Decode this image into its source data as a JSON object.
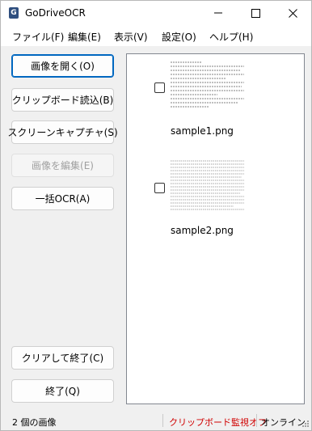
{
  "window": {
    "title": "GoDriveOCR",
    "icon": "G",
    "controls": [
      "minimize-icon",
      "maximize-icon",
      "close-icon"
    ]
  },
  "menu": {
    "file": "ファイル(F)",
    "edit": "編集(E)",
    "view": "表示(V)",
    "settings": "設定(O)",
    "help": "ヘルプ(H)"
  },
  "buttons": {
    "open_image": "画像を開く(O)",
    "clipboard_read": "クリップボード読込(B)",
    "screen_capture": "スクリーンキャプチャ(S)",
    "edit_image": "画像を編集(E)",
    "batch_ocr": "一括OCR(A)",
    "clear_and_exit": "クリアして終了(C)",
    "exit": "終了(Q)"
  },
  "images": [
    {
      "filename": "sample1.png",
      "checked": false
    },
    {
      "filename": "sample2.png",
      "checked": false
    }
  ],
  "status": {
    "count": "2 個の画像",
    "clipboard_monitor": "クリップボード監視オフ",
    "clipboard_monitor_color": "#d00000",
    "connection": "オンライン"
  }
}
